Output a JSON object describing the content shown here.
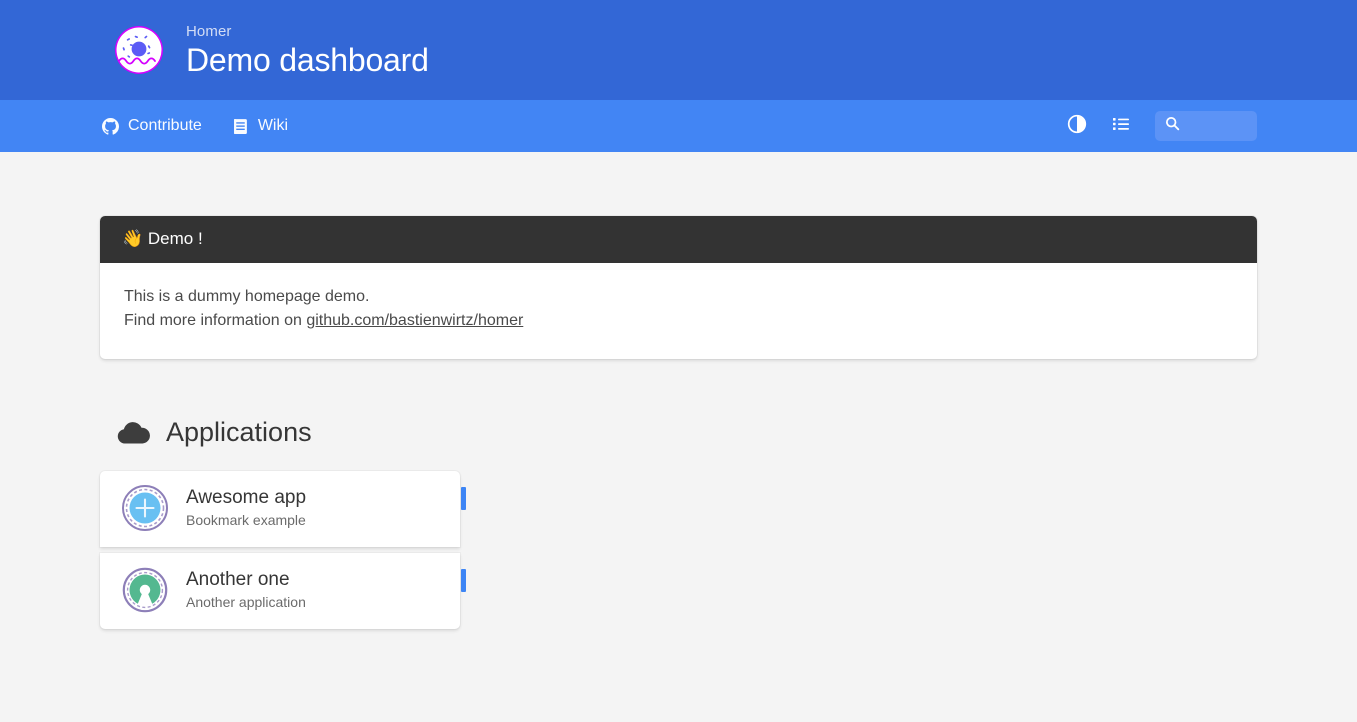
{
  "colors": {
    "header_bg": "#3367d6",
    "navbar_bg": "#4285f4",
    "page_bg": "#f4f4f4",
    "message_head_bg": "#333333",
    "tag_accent": "#3d85f5",
    "search_bg": "#5c93f6"
  },
  "header": {
    "subtitle": "Homer",
    "title": "Demo dashboard",
    "logo_icon": "donut-logo-icon"
  },
  "navbar": {
    "links": [
      {
        "label": "Contribute",
        "icon": "github-icon"
      },
      {
        "label": "Wiki",
        "icon": "book-icon"
      }
    ],
    "actions": [
      {
        "name": "dark-mode-toggle",
        "icon": "contrast-circle-icon"
      },
      {
        "name": "layout-toggle",
        "icon": "list-icon"
      }
    ],
    "search": {
      "icon": "search-icon",
      "value": "",
      "placeholder": ""
    }
  },
  "message": {
    "heading": "👋 Demo !",
    "line1": "This is a dummy homepage demo.",
    "line2_prefix": "Find more information on ",
    "link_text": "github.com/bastienwirtz/homer"
  },
  "groups": [
    {
      "title": "Applications",
      "icon": "cloud-icon",
      "items": [
        {
          "name": "Awesome app",
          "subtitle": "Bookmark example",
          "icon": "blue-plus-badge-icon",
          "tag": ""
        },
        {
          "name": "Another one",
          "subtitle": "Another application",
          "icon": "open-source-badge-icon",
          "tag": ""
        }
      ]
    }
  ]
}
